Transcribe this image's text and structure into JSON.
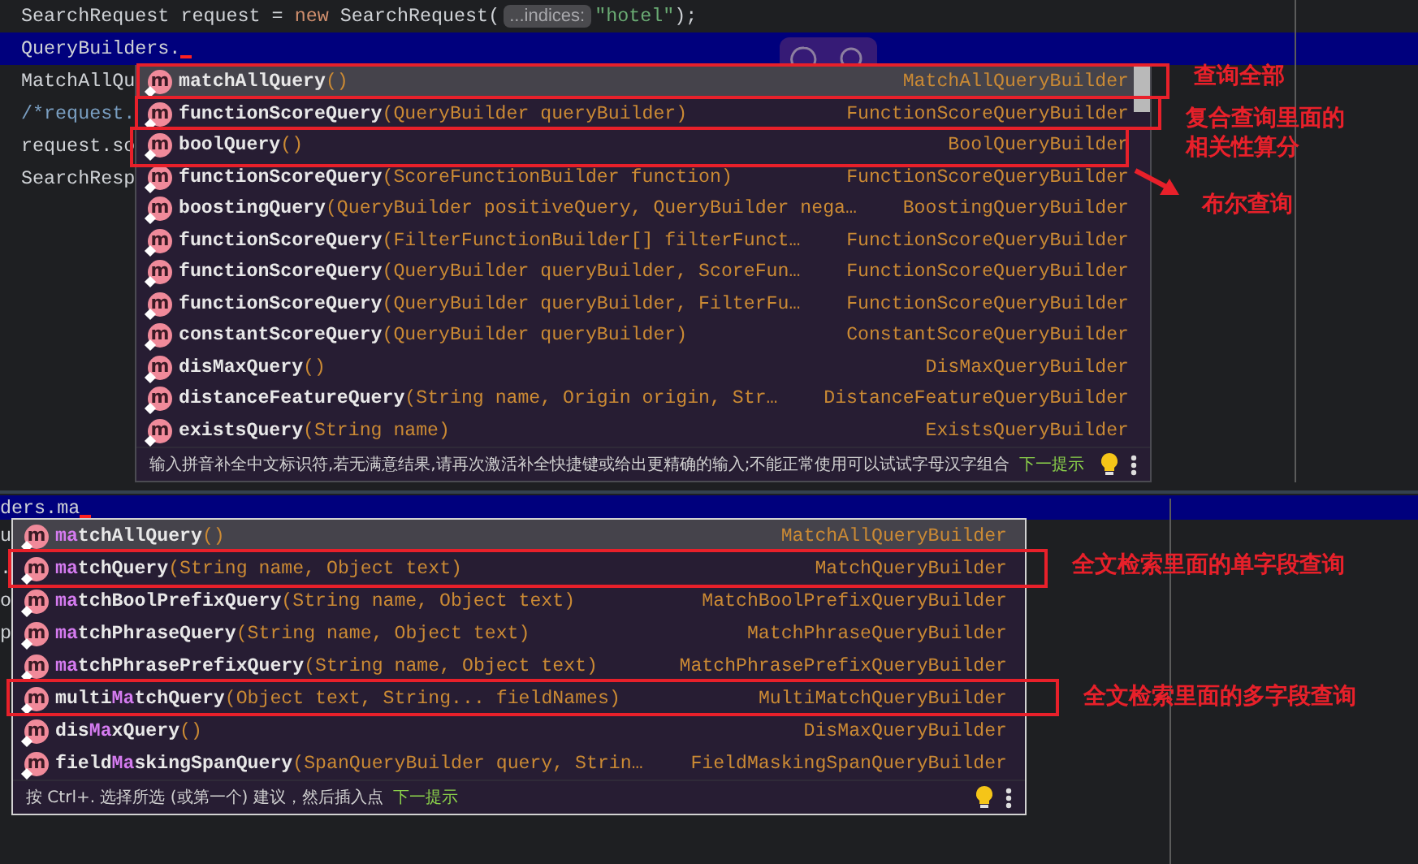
{
  "top": {
    "editor": {
      "lines": [
        {
          "current": false,
          "cursor": false,
          "tokens": [
            {
              "kind": "plain",
              "text": "SearchRequest request = "
            },
            {
              "kind": "keyword",
              "text": "new"
            },
            {
              "kind": "plain",
              "text": " SearchRequest("
            },
            {
              "kind": "hint",
              "text": "...indices:"
            },
            {
              "kind": "string",
              "text": "\"hotel\""
            },
            {
              "kind": "plain",
              "text": ");"
            }
          ]
        },
        {
          "current": true,
          "cursor": true,
          "tokens": [
            {
              "kind": "plain",
              "text": "QueryBuilders."
            }
          ]
        },
        {
          "current": false,
          "tokens": [
            {
              "kind": "plain",
              "text": "MatchAllQu"
            }
          ]
        },
        {
          "current": false,
          "tokens": [
            {
              "kind": "comment",
              "text": "/*request."
            }
          ]
        },
        {
          "current": false,
          "tokens": [
            {
              "kind": "plain",
              "text": "request.so"
            }
          ]
        },
        {
          "current": false,
          "tokens": [
            {
              "kind": "plain",
              "text": "SearchResp"
            }
          ]
        }
      ]
    },
    "popup": {
      "items": [
        {
          "icon": "m",
          "selected": true,
          "boxed": true,
          "note": {
            "arrow": false,
            "lines": [
              "查询全部"
            ]
          },
          "name": "matchAllQuery",
          "params": "()",
          "type": "MatchAllQueryBuilder"
        },
        {
          "icon": "m",
          "selected": false,
          "boxed": true,
          "note": {
            "arrow": false,
            "lines": [
              "复合查询里面的",
              "相关性算分"
            ]
          },
          "name": "functionScoreQuery",
          "params": "(QueryBuilder queryBuilder)",
          "type": "FunctionScoreQueryBuilder"
        },
        {
          "icon": "m",
          "selected": false,
          "boxed": true,
          "note": {
            "arrow": true,
            "lines": [
              "布尔查询"
            ]
          },
          "name": "boolQuery",
          "params": "()",
          "type": "BoolQueryBuilder"
        },
        {
          "icon": "m",
          "selected": false,
          "boxed": false,
          "name": "functionScoreQuery",
          "params": "(ScoreFunctionBuilder function)",
          "type": "FunctionScoreQueryBuilder"
        },
        {
          "icon": "m",
          "selected": false,
          "boxed": false,
          "name": "boostingQuery",
          "params": "(QueryBuilder positiveQuery, QueryBuilder nega…",
          "type": "BoostingQueryBuilder"
        },
        {
          "icon": "m",
          "selected": false,
          "boxed": false,
          "name": "functionScoreQuery",
          "params": "(FilterFunctionBuilder[] filterFunct…",
          "type": "FunctionScoreQueryBuilder"
        },
        {
          "icon": "m",
          "selected": false,
          "boxed": false,
          "name": "functionScoreQuery",
          "params": "(QueryBuilder queryBuilder, ScoreFun…",
          "type": "FunctionScoreQueryBuilder"
        },
        {
          "icon": "m",
          "selected": false,
          "boxed": false,
          "name": "functionScoreQuery",
          "params": "(QueryBuilder queryBuilder, FilterFu…",
          "type": "FunctionScoreQueryBuilder"
        },
        {
          "icon": "m",
          "selected": false,
          "boxed": false,
          "name": "constantScoreQuery",
          "params": "(QueryBuilder queryBuilder)",
          "type": "ConstantScoreQueryBuilder"
        },
        {
          "icon": "m",
          "selected": false,
          "boxed": false,
          "name": "disMaxQuery",
          "params": "()",
          "type": "DisMaxQueryBuilder"
        },
        {
          "icon": "m",
          "selected": false,
          "boxed": false,
          "name": "distanceFeatureQuery",
          "params": "(String name, Origin origin, Str…",
          "type": "DistanceFeatureQueryBuilder"
        },
        {
          "icon": "m",
          "selected": false,
          "boxed": false,
          "name": "existsQuery",
          "params": "(String name)",
          "type": "ExistsQueryBuilder"
        }
      ],
      "footer": {
        "text": "输入拼音补全中文标识符,若无满意结果,请再次激活补全快捷键或给出更精确的输入;不能正常使用可以试试字母汉字组合",
        "link": "下一提示"
      }
    }
  },
  "bottom": {
    "editor": {
      "lines": [
        {
          "current": true,
          "cursor": true,
          "tokens": [
            {
              "kind": "plain",
              "text": "ders.ma"
            }
          ]
        },
        {
          "current": false,
          "tokens": [
            {
              "kind": "plain",
              "text": "u"
            }
          ]
        },
        {
          "current": false,
          "tokens": [
            {
              "kind": "plain",
              "text": "."
            }
          ]
        },
        {
          "current": false,
          "tokens": [
            {
              "kind": "plain",
              "text": "o"
            }
          ]
        },
        {
          "current": false,
          "tokens": [
            {
              "kind": "plain",
              "text": "p"
            }
          ]
        }
      ]
    },
    "popup": {
      "items": [
        {
          "icon": "m",
          "selected": true,
          "boxed": false,
          "name_parts": [
            {
              "text": "ma",
              "matched": true
            },
            {
              "text": "tchAllQuery",
              "matched": false
            }
          ],
          "params": "()",
          "type": "MatchAllQueryBuilder"
        },
        {
          "icon": "m",
          "selected": false,
          "boxed": true,
          "note": {
            "arrow": false,
            "lines": [
              "全文检索里面的单字段查询"
            ]
          },
          "name_parts": [
            {
              "text": "ma",
              "matched": true
            },
            {
              "text": "tchQuery",
              "matched": false
            }
          ],
          "params": "(String name, Object text)",
          "type": "MatchQueryBuilder"
        },
        {
          "icon": "m",
          "selected": false,
          "boxed": false,
          "name_parts": [
            {
              "text": "ma",
              "matched": true
            },
            {
              "text": "tchBoolPrefixQuery",
              "matched": false
            }
          ],
          "params": "(String name, Object text)",
          "type": "MatchBoolPrefixQueryBuilder"
        },
        {
          "icon": "m",
          "selected": false,
          "boxed": false,
          "name_parts": [
            {
              "text": "ma",
              "matched": true
            },
            {
              "text": "tchPhraseQuery",
              "matched": false
            }
          ],
          "params": "(String name, Object text)",
          "type": "MatchPhraseQueryBuilder"
        },
        {
          "icon": "m",
          "selected": false,
          "boxed": false,
          "name_parts": [
            {
              "text": "ma",
              "matched": true
            },
            {
              "text": "tchPhrasePrefixQuery",
              "matched": false
            }
          ],
          "params": "(String name, Object text)",
          "type": "MatchPhrasePrefixQueryBuilder"
        },
        {
          "icon": "m",
          "selected": false,
          "boxed": true,
          "note": {
            "arrow": false,
            "lines": [
              "全文检索里面的多字段查询"
            ]
          },
          "name_parts": [
            {
              "text": "multi",
              "matched": false
            },
            {
              "text": "Ma",
              "matched": true
            },
            {
              "text": "tchQuery",
              "matched": false
            }
          ],
          "params": "(Object text, String... fieldNames)",
          "type": "MultiMatchQueryBuilder"
        },
        {
          "icon": "m",
          "selected": false,
          "boxed": false,
          "name_parts": [
            {
              "text": "dis",
              "matched": false
            },
            {
              "text": "Ma",
              "matched": true
            },
            {
              "text": "xQuery",
              "matched": false
            }
          ],
          "params": "()",
          "type": "DisMaxQueryBuilder"
        },
        {
          "icon": "m",
          "selected": false,
          "boxed": false,
          "name_parts": [
            {
              "text": "field",
              "matched": false
            },
            {
              "text": "Ma",
              "matched": true
            },
            {
              "text": "skingSpanQuery",
              "matched": false
            }
          ],
          "params": "(SpanQueryBuilder query, Strin…",
          "type": "FieldMaskingSpanQueryBuilder"
        }
      ],
      "footer": {
        "text": "按 Ctrl+. 选择所选 (或第一个) 建议，然后插入点",
        "link": "下一提示"
      }
    }
  }
}
